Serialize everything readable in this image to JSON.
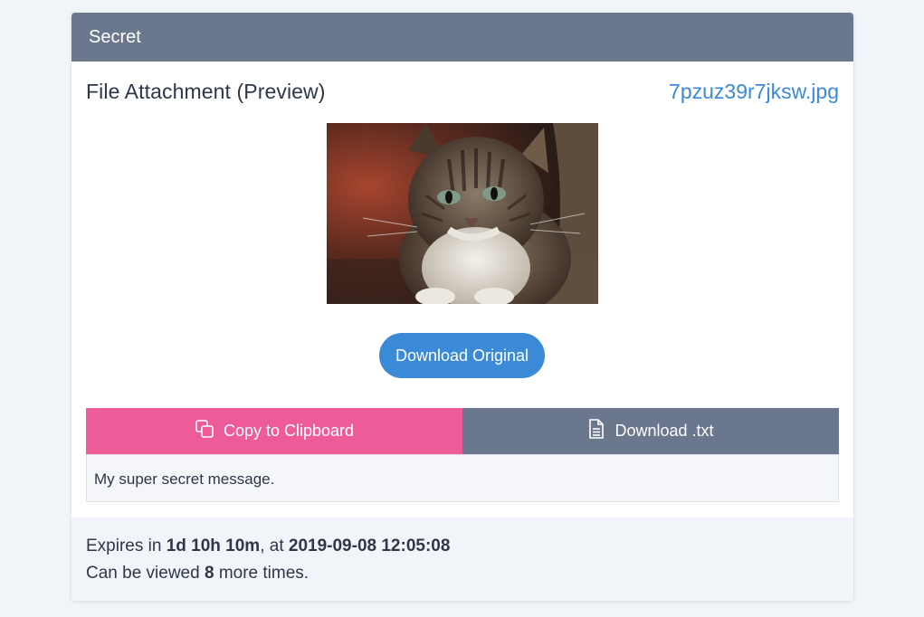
{
  "card": {
    "header_title": "Secret"
  },
  "attachment": {
    "title": "File Attachment (Preview)",
    "filename": "7pzuz39r7jksw.jpg",
    "image_alt": "cat photo preview",
    "download_label": "Download Original"
  },
  "actions": {
    "copy_label": "Copy to Clipboard",
    "copy_icon": "clipboard-copy-icon",
    "download_txt_label": "Download .txt",
    "download_txt_icon": "document-icon"
  },
  "message": {
    "text": "My super secret message."
  },
  "footer": {
    "expires_prefix": "Expires in ",
    "expires_duration": "1d 10h 10m",
    "expires_mid": ", at ",
    "expires_datetime": "2019-09-08 12:05:08",
    "views_prefix": "Can be viewed ",
    "views_count": "8",
    "views_suffix": " more times."
  },
  "colors": {
    "header_bg": "#6b778d",
    "link": "#3a8ad8",
    "primary_button": "#3a8ad8",
    "copy_button": "#ed5b99",
    "txt_button": "#6b778d",
    "page_bg": "#f1f5f9"
  }
}
